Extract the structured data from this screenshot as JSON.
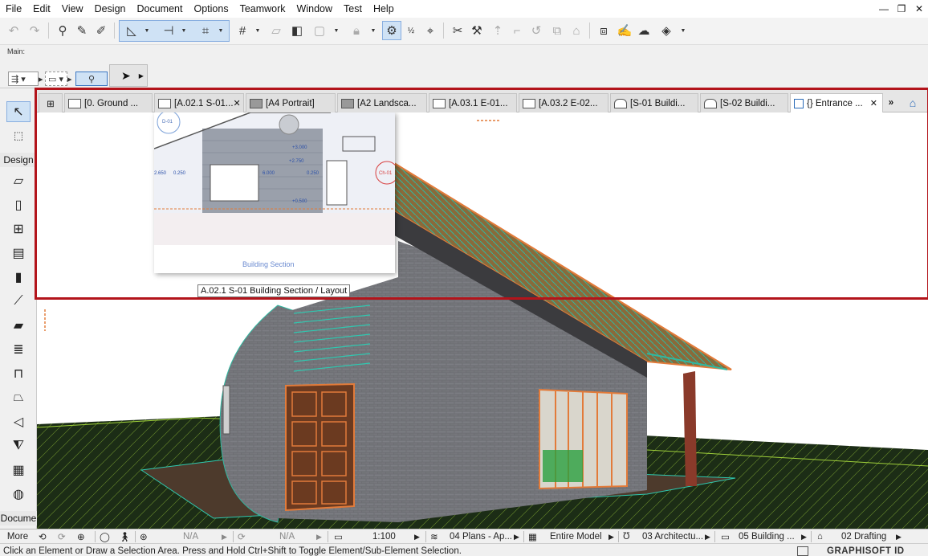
{
  "menubar": {
    "items": [
      "File",
      "Edit",
      "View",
      "Design",
      "Document",
      "Options",
      "Teamwork",
      "Window",
      "Test",
      "Help"
    ],
    "window_controls": [
      "—",
      "❐",
      "✕"
    ]
  },
  "infobox": {
    "label": "Main:"
  },
  "toolbox": {
    "design_header": "Design",
    "document_header": "Docume",
    "more_label": "More"
  },
  "tabs": [
    {
      "label": "[0. Ground ...",
      "icon": "floor-plan-icon"
    },
    {
      "label": "[A.02.1 S-01...",
      "icon": "layout-icon",
      "close": "✕"
    },
    {
      "label": "[A4 Portrait]",
      "icon": "master-layout-icon"
    },
    {
      "label": "[A2 Landsca...",
      "icon": "master-layout-icon"
    },
    {
      "label": "[A.03.1 E-01...",
      "icon": "layout-icon"
    },
    {
      "label": "[A.03.2 E-02...",
      "icon": "layout-icon"
    },
    {
      "label": "[S-01 Buildi...",
      "icon": "section-icon"
    },
    {
      "label": "[S-02 Buildi...",
      "icon": "section-icon"
    },
    {
      "label": "{} Entrance ...",
      "icon": "3d-view-icon",
      "close": "✕",
      "active": true
    }
  ],
  "tab_overflow": "»",
  "preview": {
    "caption": "A.02.1 S-01 Building Section / Layout",
    "drawing_title": "Building Section",
    "marker_left": "D-01",
    "marker_right": "Ch-01",
    "dims": [
      "2.650",
      "0.250",
      "6.000",
      "0.250",
      "+3.000",
      "+2.750",
      "+0.500"
    ]
  },
  "navbar": {
    "na1": "N/A",
    "na2": "N/A",
    "scale": "1:100",
    "layer_combo": "04 Plans - Ap...",
    "model_view": "Entire Model",
    "renovation": "03 Architectu...",
    "pen_set": "05 Building ...",
    "drafting": "02 Drafting"
  },
  "statusbar": {
    "message": "Click an Element or Draw a Selection Area. Press and Hold Ctrl+Shift to Toggle Element/Sub-Element Selection.",
    "brand": "GRAPHISOFT ID"
  }
}
